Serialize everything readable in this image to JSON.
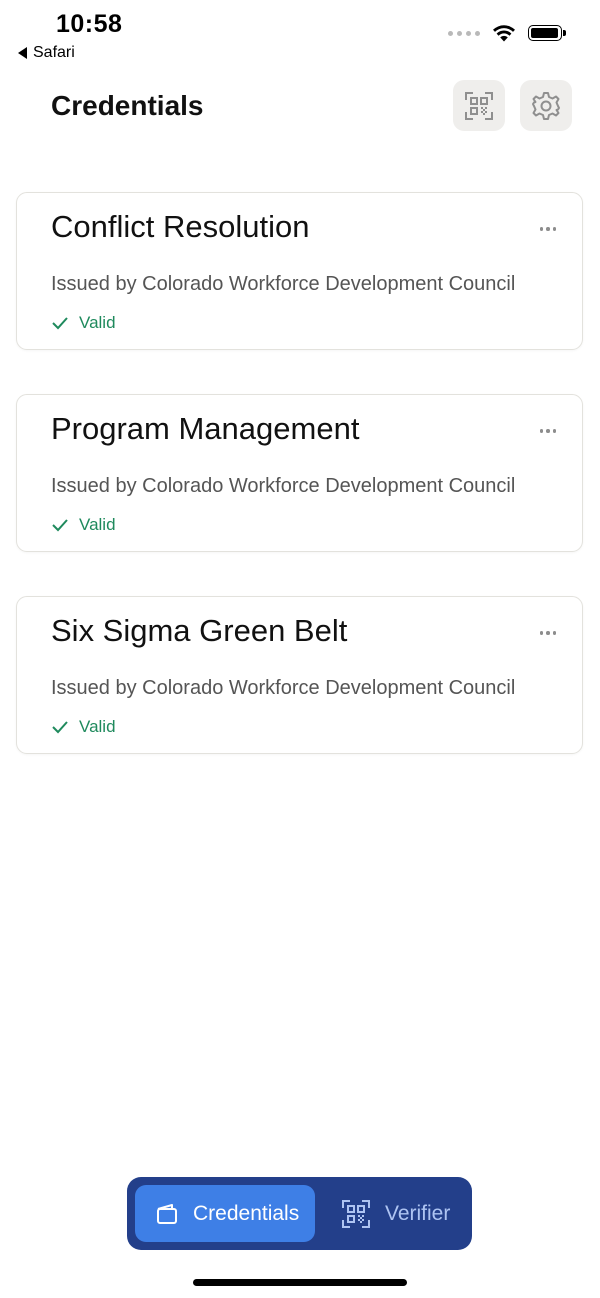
{
  "status_bar": {
    "time": "10:58",
    "back_app": "Safari"
  },
  "header": {
    "title": "Credentials",
    "qr_button_icon": "qr-code-icon",
    "settings_button_icon": "gear-icon"
  },
  "credentials": [
    {
      "title": "Conflict Resolution",
      "issuer": "Issued by Colorado Workforce Development Council",
      "status": "Valid"
    },
    {
      "title": "Program Management",
      "issuer": "Issued by Colorado Workforce Development Council",
      "status": "Valid"
    },
    {
      "title": "Six Sigma Green Belt",
      "issuer": "Issued by Colorado Workforce Development Council",
      "status": "Valid"
    }
  ],
  "tabbar": {
    "tabs": [
      {
        "label": "Credentials",
        "icon": "wallet-icon",
        "active": true
      },
      {
        "label": "Verifier",
        "icon": "qr-scan-icon",
        "active": false
      }
    ]
  },
  "colors": {
    "accent": "#3e7fe6",
    "tabbar_bg": "#233f8a",
    "valid_green": "#1f8a5d",
    "header_button_bg": "#efeeec"
  }
}
